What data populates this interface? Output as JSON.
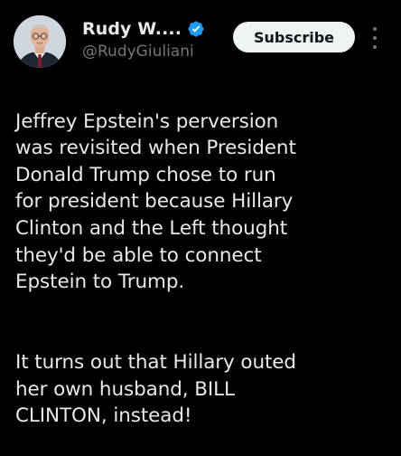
{
  "colors": {
    "background": "#000000",
    "primary_text": "#e7e9ea",
    "secondary_text": "#71767b",
    "verified_badge": "#1d9bf0",
    "button_background": "#eff3f4",
    "button_text": "#0f1419"
  },
  "author": {
    "display_name": "Rudy W....",
    "handle": "@RudyGiuliani",
    "verified_icon": "verified-badge-icon",
    "avatar_icon": "profile-photo"
  },
  "actions": {
    "subscribe_label": "Subscribe",
    "more_icon": "more-options-icon"
  },
  "post": {
    "paragraphs": [
      "Jeffrey Epstein's perversion\nwas revisited when President\nDonald Trump chose to run\nfor president because Hillary\nClinton and the Left thought\nthey'd be able to connect\nEpstein to Trump.",
      "It turns out that Hillary outed\nher own husband, BILL\nCLINTON, instead!"
    ]
  }
}
